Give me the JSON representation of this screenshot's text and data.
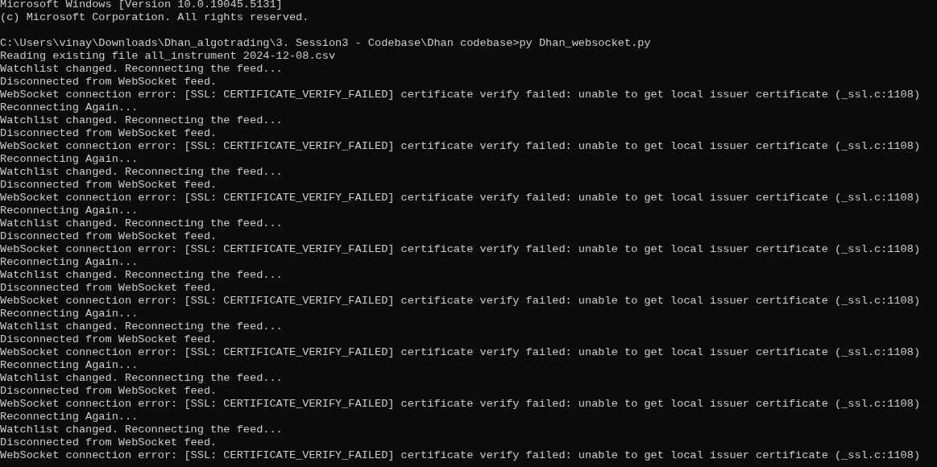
{
  "header": [
    "Microsoft Windows [Version 10.0.19045.5131]",
    "(c) Microsoft Corporation. All rights reserved."
  ],
  "session": [
    "C:\\Users\\vinay\\Downloads\\Dhan_algotrading\\3. Session3 - Codebase\\Dhan codebase>py Dhan_websocket.py",
    "Reading existing file all_instrument 2024-12-08.csv",
    "Watchlist changed. Reconnecting the feed...",
    "Disconnected from WebSocket feed.",
    "WebSocket connection error: [SSL: CERTIFICATE_VERIFY_FAILED] certificate verify failed: unable to get local issuer certificate (_ssl.c:1108)",
    "Reconnecting Again...",
    "Watchlist changed. Reconnecting the feed...",
    "Disconnected from WebSocket feed.",
    "WebSocket connection error: [SSL: CERTIFICATE_VERIFY_FAILED] certificate verify failed: unable to get local issuer certificate (_ssl.c:1108)",
    "Reconnecting Again...",
    "Watchlist changed. Reconnecting the feed...",
    "Disconnected from WebSocket feed.",
    "WebSocket connection error: [SSL: CERTIFICATE_VERIFY_FAILED] certificate verify failed: unable to get local issuer certificate (_ssl.c:1108)",
    "Reconnecting Again...",
    "Watchlist changed. Reconnecting the feed...",
    "Disconnected from WebSocket feed.",
    "WebSocket connection error: [SSL: CERTIFICATE_VERIFY_FAILED] certificate verify failed: unable to get local issuer certificate (_ssl.c:1108)",
    "Reconnecting Again...",
    "Watchlist changed. Reconnecting the feed...",
    "Disconnected from WebSocket feed.",
    "WebSocket connection error: [SSL: CERTIFICATE_VERIFY_FAILED] certificate verify failed: unable to get local issuer certificate (_ssl.c:1108)",
    "Reconnecting Again...",
    "Watchlist changed. Reconnecting the feed...",
    "Disconnected from WebSocket feed.",
    "WebSocket connection error: [SSL: CERTIFICATE_VERIFY_FAILED] certificate verify failed: unable to get local issuer certificate (_ssl.c:1108)",
    "Reconnecting Again...",
    "Watchlist changed. Reconnecting the feed...",
    "Disconnected from WebSocket feed.",
    "WebSocket connection error: [SSL: CERTIFICATE_VERIFY_FAILED] certificate verify failed: unable to get local issuer certificate (_ssl.c:1108)",
    "Reconnecting Again...",
    "Watchlist changed. Reconnecting the feed...",
    "Disconnected from WebSocket feed.",
    "WebSocket connection error: [SSL: CERTIFICATE_VERIFY_FAILED] certificate verify failed: unable to get local issuer certificate (_ssl.c:1108)"
  ]
}
